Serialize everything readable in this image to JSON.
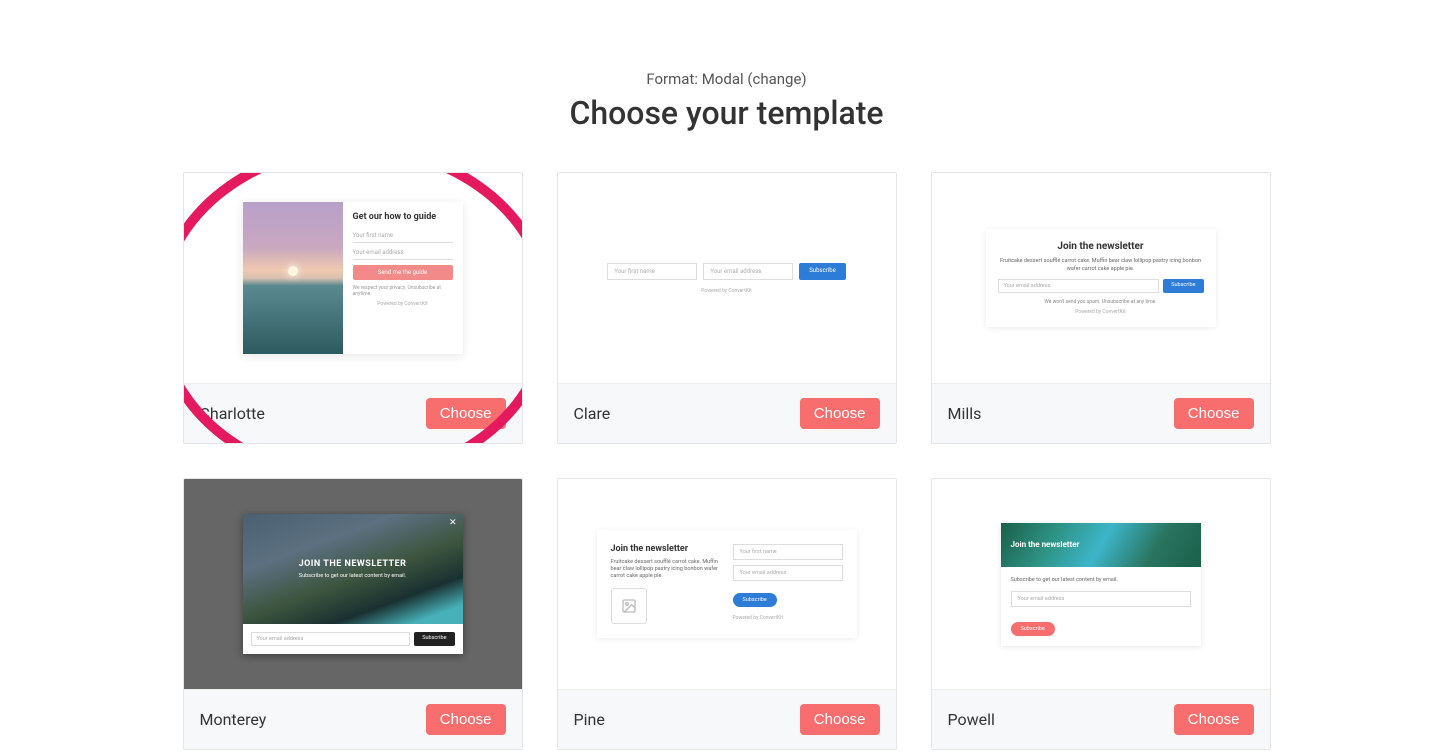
{
  "header": {
    "format_prefix": "Format: ",
    "format_value": "Modal",
    "format_change": " (change)",
    "title": "Choose your template"
  },
  "choose_label": "Choose",
  "templates": [
    {
      "name": "Charlotte",
      "highlighted": true,
      "preview": {
        "heading": "Get our how to guide",
        "field1": "Your first name",
        "field2": "Your email address",
        "button": "Send me the guide",
        "privacy": "We respect your privacy. Unsubscribe at anytime.",
        "powered": "Powered by ConvertKit"
      }
    },
    {
      "name": "Clare",
      "preview": {
        "field1": "Your first name",
        "field2": "Your email address",
        "button": "Subscribe",
        "powered": "Powered by ConvertKit"
      }
    },
    {
      "name": "Mills",
      "preview": {
        "heading": "Join the newsletter",
        "desc": "Fruitcake dessert soufflé carrot cake. Muffin bear claw lollipop pastry icing bonbon wafer carrot cake apple pie.",
        "field1": "Your email address",
        "button": "Subscribe",
        "note": "We won't send you spam. Unsubscribe at any time.",
        "powered": "Powered by ConvertKit"
      }
    },
    {
      "name": "Monterey",
      "preview": {
        "heading": "JOIN THE NEWSLETTER",
        "sub": "Subscribe to get our latest content by email.",
        "field1": "Your email address",
        "button": "Subscribe"
      }
    },
    {
      "name": "Pine",
      "preview": {
        "heading": "Join the newsletter",
        "desc": "Fruitcake dessert soufflé carrot cake. Muffin bear claw lollipop pastry icing bonbon wafer carrot cake apple pie.",
        "field1": "Your first name",
        "field2": "Your email address",
        "button": "Subscribe",
        "powered": "Powered by ConvertKit"
      }
    },
    {
      "name": "Powell",
      "preview": {
        "heading": "Join the newsletter",
        "sub": "Subscribe to get our latest content by email.",
        "field1": "Your email address",
        "button": "Subscribe"
      }
    }
  ]
}
